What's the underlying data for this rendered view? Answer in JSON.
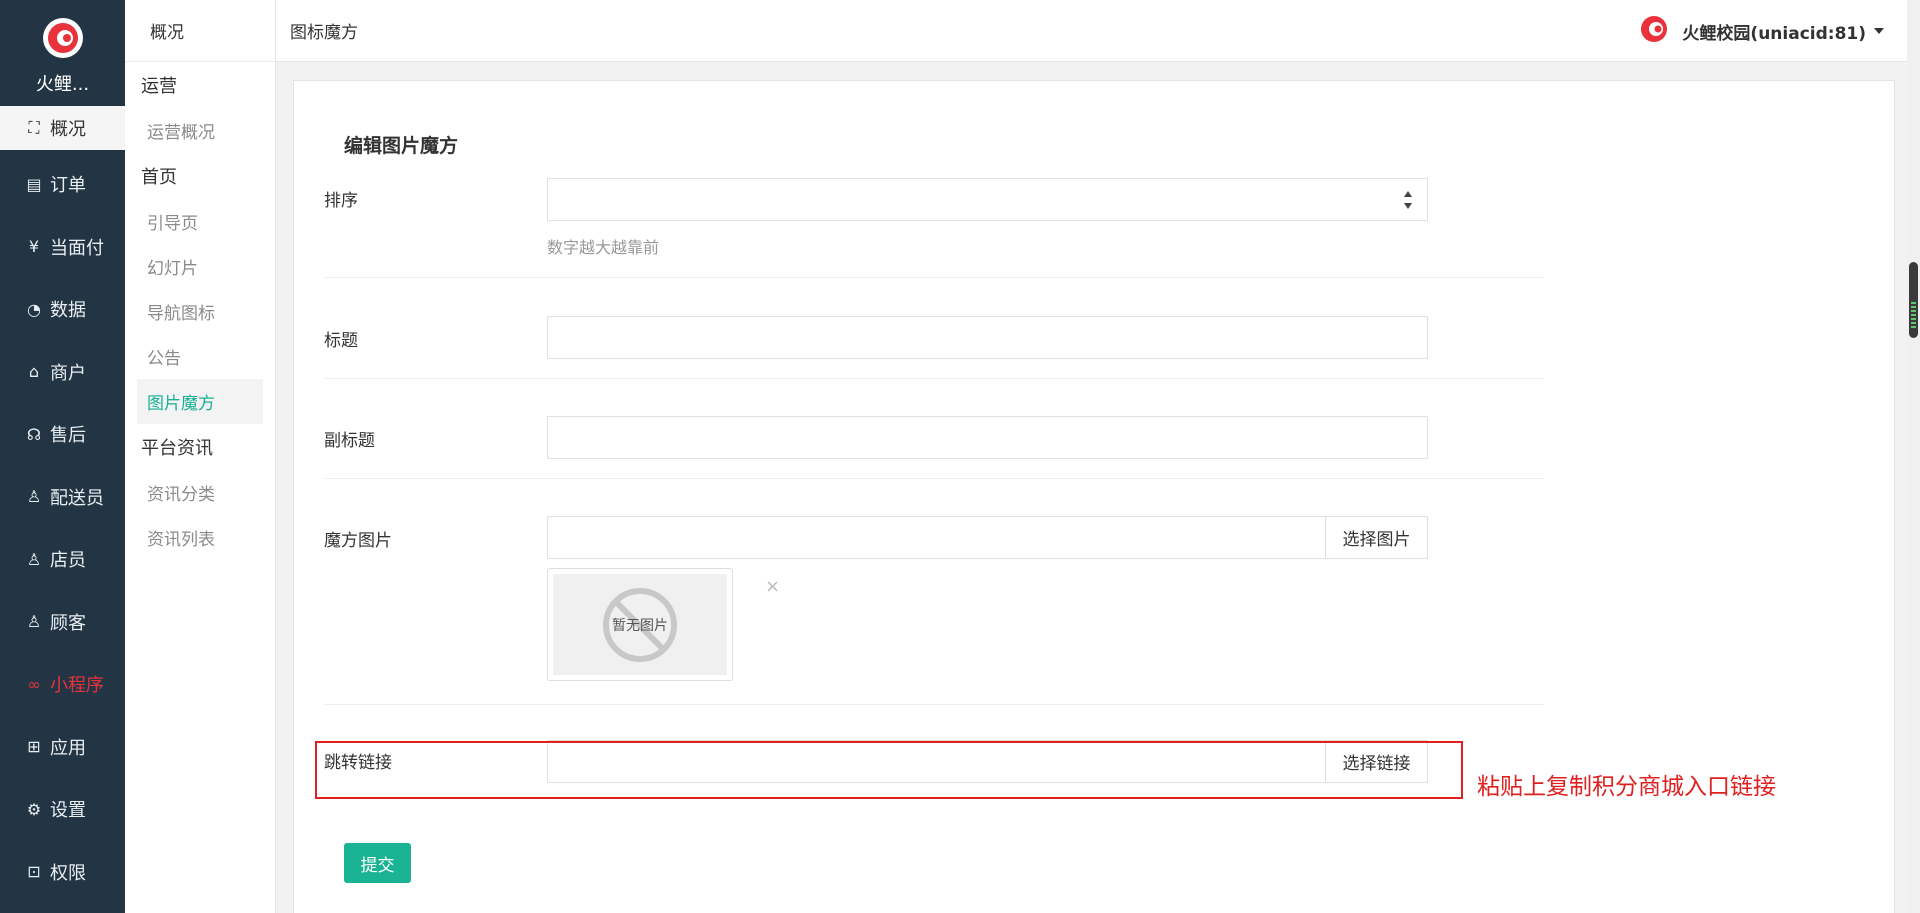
{
  "brand": {
    "name": "火鲤..."
  },
  "nav_dark": [
    {
      "label": "概况",
      "icon": "overview-icon",
      "active": true
    },
    {
      "label": "订单",
      "icon": "order-icon"
    },
    {
      "label": "当面付",
      "icon": "yen-icon"
    },
    {
      "label": "数据",
      "icon": "chart-icon"
    },
    {
      "label": "商户",
      "icon": "store-icon"
    },
    {
      "label": "售后",
      "icon": "headset-icon"
    },
    {
      "label": "配送员",
      "icon": "courier-icon"
    },
    {
      "label": "店员",
      "icon": "clerk-icon"
    },
    {
      "label": "顾客",
      "icon": "customer-icon"
    },
    {
      "label": "小程序",
      "icon": "miniapp-icon",
      "highlight": true
    },
    {
      "label": "应用",
      "icon": "apps-icon"
    },
    {
      "label": "设置",
      "icon": "gear-icon"
    },
    {
      "label": "权限",
      "icon": "lock-icon"
    }
  ],
  "nav_sub": {
    "top": "概况",
    "groups": [
      {
        "title": "运营",
        "items": [
          "运营概况"
        ]
      },
      {
        "title": "首页",
        "items": [
          "引导页",
          "幻灯片",
          "导航图标",
          "公告",
          "图片魔方"
        ]
      },
      {
        "title": "平台资讯",
        "items": [
          "资讯分类",
          "资讯列表"
        ]
      }
    ],
    "active_item": "图片魔方"
  },
  "header": {
    "title": "图标魔方",
    "user": "火鲤校园(uniacid:81)"
  },
  "form": {
    "title": "编辑图片魔方",
    "sort_label": "排序",
    "sort_help": "数字越大越靠前",
    "title_label": "标题",
    "subtitle_label": "副标题",
    "image_label": "魔方图片",
    "select_image": "选择图片",
    "no_image": "暂无图片",
    "remove": "×",
    "link_label": "跳转链接",
    "select_link": "选择链接",
    "submit": "提交"
  },
  "annotation": {
    "note": "粘贴上复制积分商城入口链接"
  },
  "colors": {
    "accent": "#1ab394",
    "sidebar": "#233544",
    "highlight": "#e02020"
  }
}
